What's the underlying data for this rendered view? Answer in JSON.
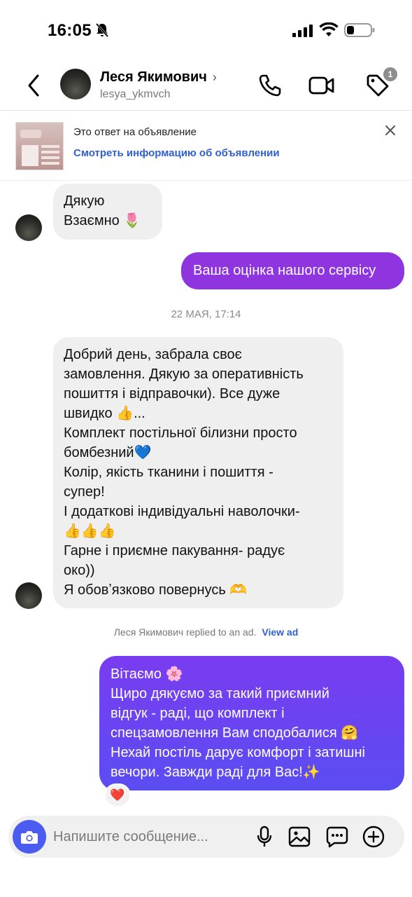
{
  "status_bar": {
    "time": "16:05",
    "icons": [
      "bell-off-icon",
      "signal-icon",
      "wifi-icon",
      "battery-icon"
    ]
  },
  "header": {
    "name": "Леся Якимович",
    "chevron": "›",
    "username": "lesya_ykmvch",
    "notification_count": "1",
    "icons": [
      "back-icon",
      "phone-icon",
      "video-icon",
      "tag-icon"
    ]
  },
  "ad_banner": {
    "title": "Это ответ на объявление",
    "link": "Смотреть информацию об объявлении",
    "icons": [
      "close-icon"
    ]
  },
  "messages": [
    {
      "direction": "in",
      "lines": [
        "Дякую",
        "Взаємно 🌷"
      ]
    },
    {
      "direction": "out",
      "lines": [
        "Ваша оцінка нашого сервісу"
      ]
    },
    {
      "direction": "in",
      "lines": [
        "Добрий день, забрала своє",
        "замовлення. Дякую за оперативність",
        "пошиття і відправочки). Все дуже",
        "швидко 👍...",
        "Комплект постільної білизни просто",
        "бомбезний💙",
        "Колір, якість тканини і пошиття -",
        "супер!",
        "І додаткові індивідуальні наволочки-",
        "👍👍👍",
        "Гарне і приємне пакування- радує",
        "око))",
        "Я обовʼязково повернусь 🫶"
      ]
    },
    {
      "direction": "out",
      "lines": [
        "Вітаємо 🌸",
        "Щиро дякуємо за такий приємний",
        "відгук - раді, що комплект і",
        "спецзамовлення Вам сподобалися 🤗",
        "Нехай постіль дарує комфорт і затишні",
        "вечори. Завжди раді для Вас!✨"
      ],
      "reaction": "❤️"
    }
  ],
  "date_separator": "22 МАЯ, 17:14",
  "reply_note": {
    "text": "Леся Якимович replied to an ad.",
    "link": "View ad"
  },
  "composer": {
    "placeholder": "Напишите сообщение...",
    "icons": [
      "camera-icon",
      "microphone-icon",
      "gallery-icon",
      "sticker-icon",
      "plus-icon"
    ]
  },
  "colors": {
    "outgoing_purple": "#8f35e0",
    "outgoing_gradient_start": "#7a3cf0",
    "outgoing_gradient_end": "#5a4df2",
    "incoming_bg": "#efefef",
    "link_blue": "#2f5fd0",
    "camera_blue": "#4b5cf0"
  }
}
